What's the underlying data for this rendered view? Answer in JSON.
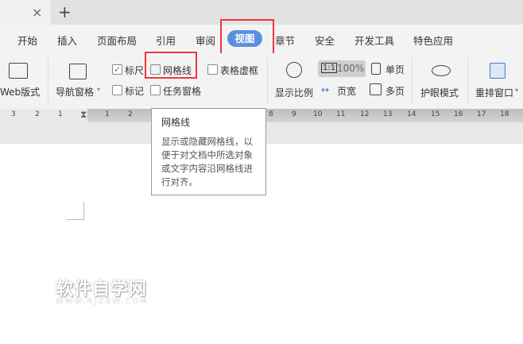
{
  "tabbar": {
    "close": "×",
    "new_tab": "+"
  },
  "menu": [
    "开始",
    "插入",
    "页面布局",
    "引用",
    "审阅",
    "视图",
    "章节",
    "安全",
    "开发工具",
    "特色应用"
  ],
  "ribbon": {
    "web": "Web版式",
    "nav": "导航窗格",
    "ruler": "标尺",
    "grid": "网格线",
    "table_border": "表格虚框",
    "mark": "标记",
    "task_pane": "任务窗格",
    "zoom": "显示比例",
    "zoom_100": "100%",
    "one_to_one": "1:1",
    "page_width": "页宽",
    "single_page": "单页",
    "multi_page": "多页",
    "eye_mode": "护眼模式",
    "rearrange": "重排窗口"
  },
  "ruler": {
    "left": [
      "3",
      "2",
      "1"
    ],
    "right": [
      "1",
      "2",
      "8",
      "9",
      "10",
      "11",
      "12",
      "13",
      "14",
      "15",
      "16",
      "17",
      "18"
    ]
  },
  "tooltip": {
    "title": "网格线",
    "body": "显示或隐藏网格线，以便于对文档中所选对象或文字内容沿网格线进行对齐。"
  },
  "watermark": {
    "title": "软件自学网",
    "url": "WWW.RJZXW.COM"
  }
}
